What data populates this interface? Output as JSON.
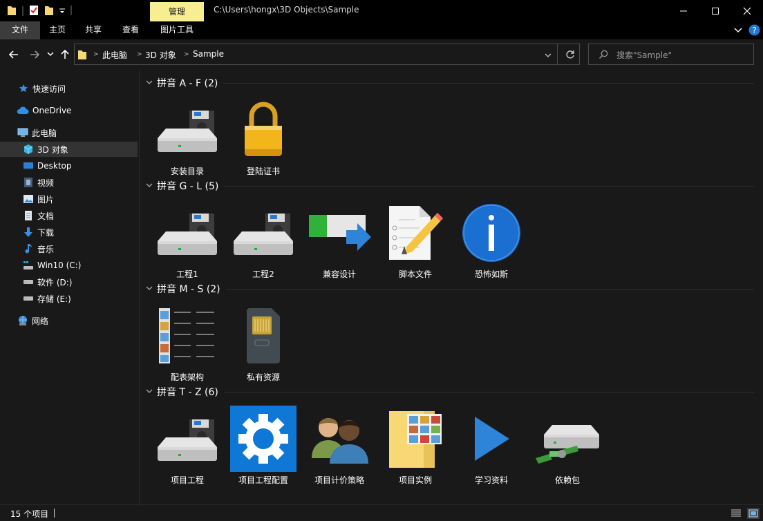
{
  "window": {
    "manage_tab": "管理",
    "title_path": "C:\\Users\\hongx\\3D Objects\\Sample"
  },
  "ribbon": {
    "tabs": [
      "文件",
      "主页",
      "共享",
      "查看",
      "图片工具"
    ]
  },
  "address": {
    "crumbs": [
      "此电脑",
      "3D 对象",
      "Sample"
    ],
    "search_placeholder": "搜索\"Sample\""
  },
  "nav": {
    "quick_access": "快速访问",
    "onedrive": "OneDrive",
    "this_pc": "此电脑",
    "items": [
      "3D 对象",
      "Desktop",
      "视频",
      "图片",
      "文档",
      "下载",
      "音乐",
      "Win10 (C:)",
      "软件 (D:)",
      "存储 (E:)"
    ],
    "network": "网络"
  },
  "groups": [
    {
      "title": "拼音 A - F (2)",
      "items": [
        "安装目录",
        "登陆证书"
      ]
    },
    {
      "title": "拼音 G - L (5)",
      "items": [
        "工程1",
        "工程2",
        "兼容设计",
        "脚本文件",
        "恐怖如斯"
      ]
    },
    {
      "title": "拼音 M - S (2)",
      "items": [
        "配表架构",
        "私有资源"
      ]
    },
    {
      "title": "拼音 T - Z (6)",
      "items": [
        "项目工程",
        "项目工程配置",
        "项目计价策略",
        "项目实例",
        "学习资料",
        "依赖包"
      ]
    }
  ],
  "status": {
    "count": "15 个项目"
  },
  "colors": {
    "manage_tab_bg": "#f7ee91",
    "accent_blue": "#0078d7",
    "folder_yellow": "#f8d775"
  }
}
